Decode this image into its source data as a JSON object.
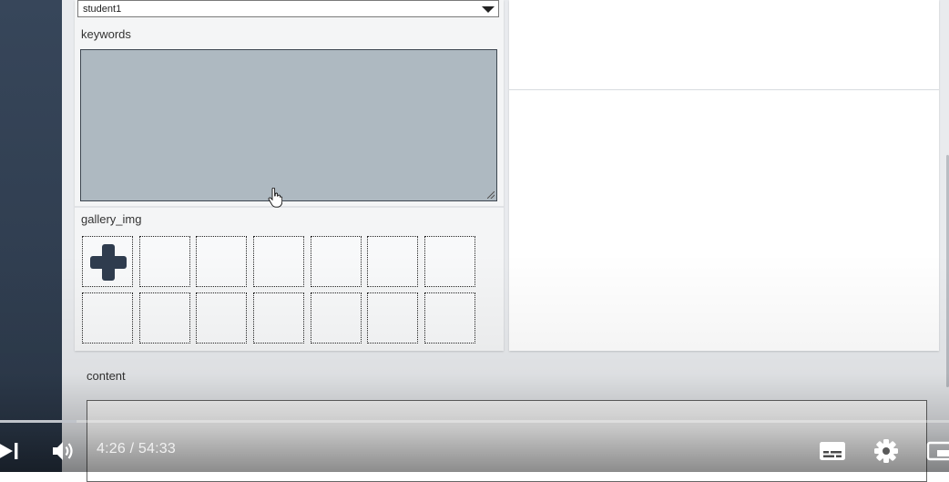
{
  "form": {
    "author_select": {
      "value": "student1"
    },
    "keywords": {
      "label": "keywords",
      "value": ""
    },
    "gallery": {
      "label": "gallery_img",
      "add_icon": "plus-icon",
      "slot_count": 14
    },
    "content": {
      "label": "content"
    }
  },
  "player": {
    "time_display": "4:26 / 54:33",
    "progress": 0.081,
    "icons": [
      "next-icon",
      "volume-icon",
      "subtitles-icon",
      "settings-icon",
      "miniplayer-icon"
    ]
  },
  "colors": {
    "textarea_bg": "#aeb9c1",
    "sidebar_bg": "#2f3c4e",
    "plus_icon": "#2f3c4e"
  }
}
